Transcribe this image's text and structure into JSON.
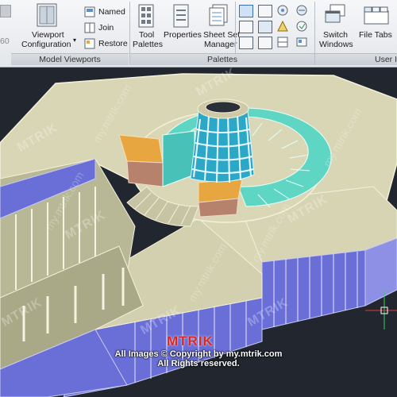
{
  "ribbon": {
    "named_label": "Named",
    "join_label": "Join",
    "restore_label": "Restore",
    "viewport_config_line1": "Viewport",
    "viewport_config_line2": "Configuration",
    "tool_palettes_line1": "Tool",
    "tool_palettes_line2": "Palettes",
    "properties_label": "Properties",
    "sheet_set_line1": "Sheet Set",
    "sheet_set_line2": "Manager",
    "switch_windows_line1": "Switch",
    "switch_windows_line2": "Windows",
    "file_tabs_label": "File Tabs",
    "left_edge_number": "60",
    "panel_model_viewports": "Model Viewports",
    "panel_palettes": "Palettes",
    "panel_user_interface": "User I"
  },
  "watermark": {
    "brand": "MTRIK",
    "url": "my.mtrik.com",
    "copyright_line1": "All Images © Copyright by my.mtrik.com",
    "copyright_line2": "All Rights reserved."
  },
  "colors": {
    "viewport_bg": "#21262f",
    "wall_purple": "#6a6fd8",
    "floor_cream": "#d9d6b8",
    "teal_seats": "#5fd6c4",
    "orange_block": "#e8a640",
    "brand_red": "#e1251b"
  }
}
